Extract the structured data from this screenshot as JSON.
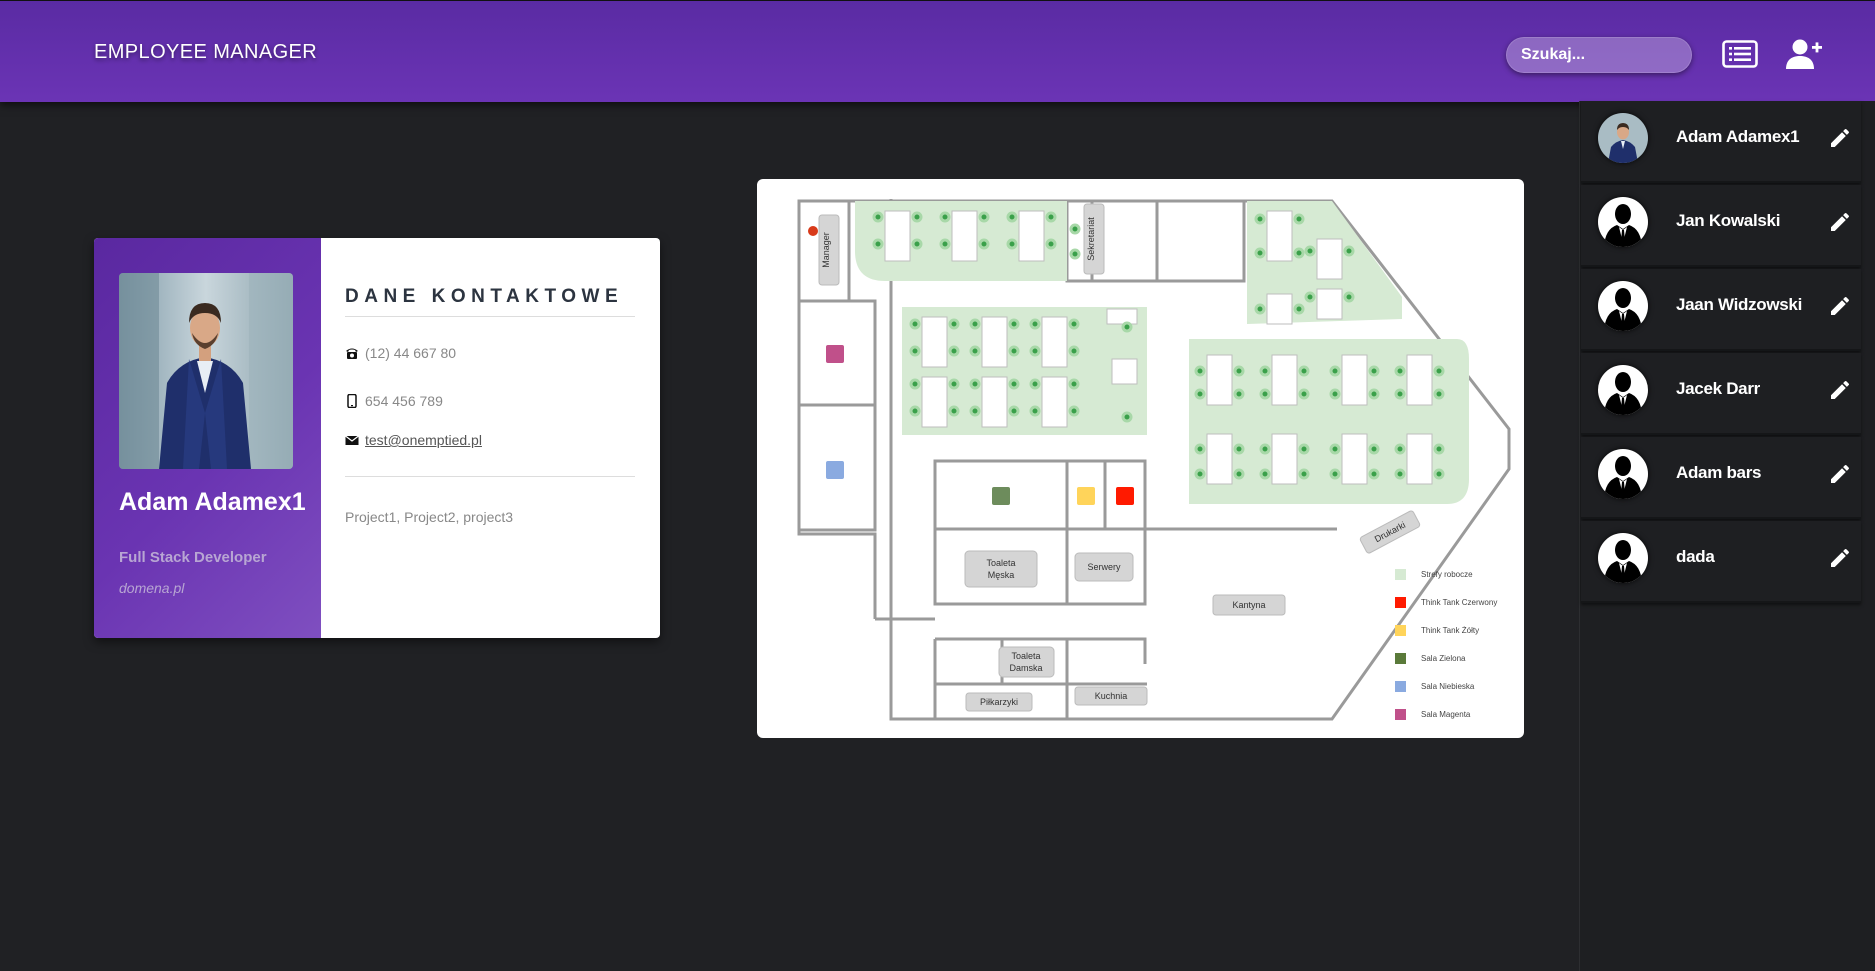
{
  "header": {
    "brand": "EMPLOYEE MANAGER",
    "search_placeholder": "Szukaj...",
    "list_icon": "list-icon",
    "add_user_icon": "add-user-icon"
  },
  "colors": {
    "header": "#6b34b5",
    "background": "#202124",
    "sidebar": "#1e1f22",
    "accent": "#5a28a0"
  },
  "profile": {
    "name": "Adam Adamex1",
    "title": "Full Stack Developer",
    "domain": "domena.pl",
    "section_title": "DANE KONTAKTOWE",
    "phone": "(12) 44 667 80",
    "mobile": "654 456 789",
    "email": "test@onemptied.pl",
    "projects": "Project1, Project2, project3"
  },
  "employees": [
    {
      "name": "Adam Adamex1",
      "avatar": "photo"
    },
    {
      "name": "Jan Kowalski",
      "avatar": "silhouette"
    },
    {
      "name": "Jaan Widzowski",
      "avatar": "silhouette"
    },
    {
      "name": "Jacek Darr",
      "avatar": "silhouette"
    },
    {
      "name": "Adam bars",
      "avatar": "silhouette"
    },
    {
      "name": "dada",
      "avatar": "silhouette"
    }
  ],
  "floorplan": {
    "rooms": {
      "manager": "Manager",
      "sekretariat": "Sekretariat",
      "toaleta_meska_1": "Toaleta",
      "toaleta_meska_2": "Męska",
      "serwery": "Serwery",
      "toaleta_damska_1": "Toaleta",
      "toaleta_damska_2": "Damska",
      "pilkarzyki": "Piłkarzyki",
      "kuchnia": "Kuchnia",
      "kantyna": "Kantyna",
      "drukarki": "Drukarki"
    },
    "legend": [
      {
        "label": "Strefy robocze",
        "color": "#d6ead3"
      },
      {
        "label": "Think Tank Czerwony",
        "color": "#ff1a00"
      },
      {
        "label": "Think Tank Żółty",
        "color": "#ffd45a"
      },
      {
        "label": "Sala Zielona",
        "color": "#5a7a3a"
      },
      {
        "label": "Sala Niebieska",
        "color": "#8aaae0"
      },
      {
        "label": "Sala Magenta",
        "color": "#c0508a"
      }
    ]
  }
}
